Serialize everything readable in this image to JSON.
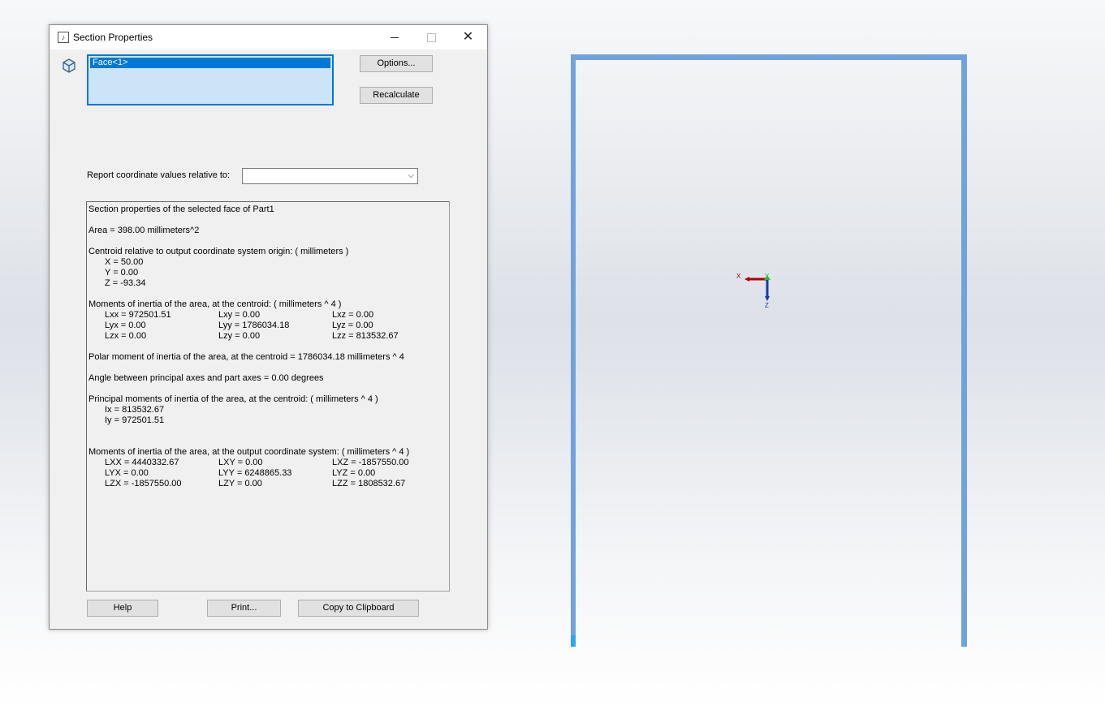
{
  "dialog": {
    "title": "Section Properties",
    "selection": [
      "Face<1>"
    ],
    "options_label": "Options...",
    "recalculate_label": "Recalculate",
    "report_label": "Report coordinate values relative to:",
    "report_value": "",
    "help_label": "Help",
    "print_label": "Print...",
    "copy_label": "Copy to Clipboard"
  },
  "results": {
    "heading": "Section properties of the selected face of Part1",
    "area": "Area = 398.00 millimeters^2",
    "centroid_heading": "Centroid relative to output coordinate system origin: ( millimeters )",
    "cx": "X = 50.00",
    "cy": "Y = 0.00",
    "cz": "Z = -93.34",
    "moi_centroid_heading": "Moments of inertia of the area, at the centroid: ( millimeters ^ 4 )",
    "lxx": "Lxx = 972501.51",
    "lxy": "Lxy = 0.00",
    "lxz": "Lxz = 0.00",
    "lyx": "Lyx = 0.00",
    "lyy": "Lyy = 1786034.18",
    "lyz": "Lyz = 0.00",
    "lzx": "Lzx = 0.00",
    "lzy": "Lzy = 0.00",
    "lzz": "Lzz = 813532.67",
    "polar": "Polar moment of inertia of the area, at the centroid = 1786034.18 millimeters ^ 4",
    "angle": "Angle between principal axes and part axes = 0.00 degrees",
    "principal_heading": "Principal moments of inertia of the area, at the centroid: ( millimeters ^ 4 )",
    "ix": "Ix = 813532.67",
    "iy": "Iy = 972501.51",
    "moi_output_heading": "Moments of inertia of the area, at the output coordinate system: ( millimeters ^ 4 )",
    "oxx": "LXX = 4440332.67",
    "oxy": "LXY = 0.00",
    "oxz": "LXZ = -1857550.00",
    "oyx": "LYX = 0.00",
    "oyy": "LYY = 6248865.33",
    "oyz": "LYZ = 0.00",
    "ozx": "LZX = -1857550.00",
    "ozy": "LZY = 0.00",
    "ozz": "LZZ = 1808532.67"
  },
  "triad": {
    "x_label": "X",
    "y_label": "Y",
    "z_label": "Z"
  },
  "colors": {
    "frame": "#6fa3dc",
    "selection": "#0078d7",
    "x_axis": "#b00000",
    "y_axis": "#2eb82e",
    "z_axis": "#1a3aa8"
  }
}
